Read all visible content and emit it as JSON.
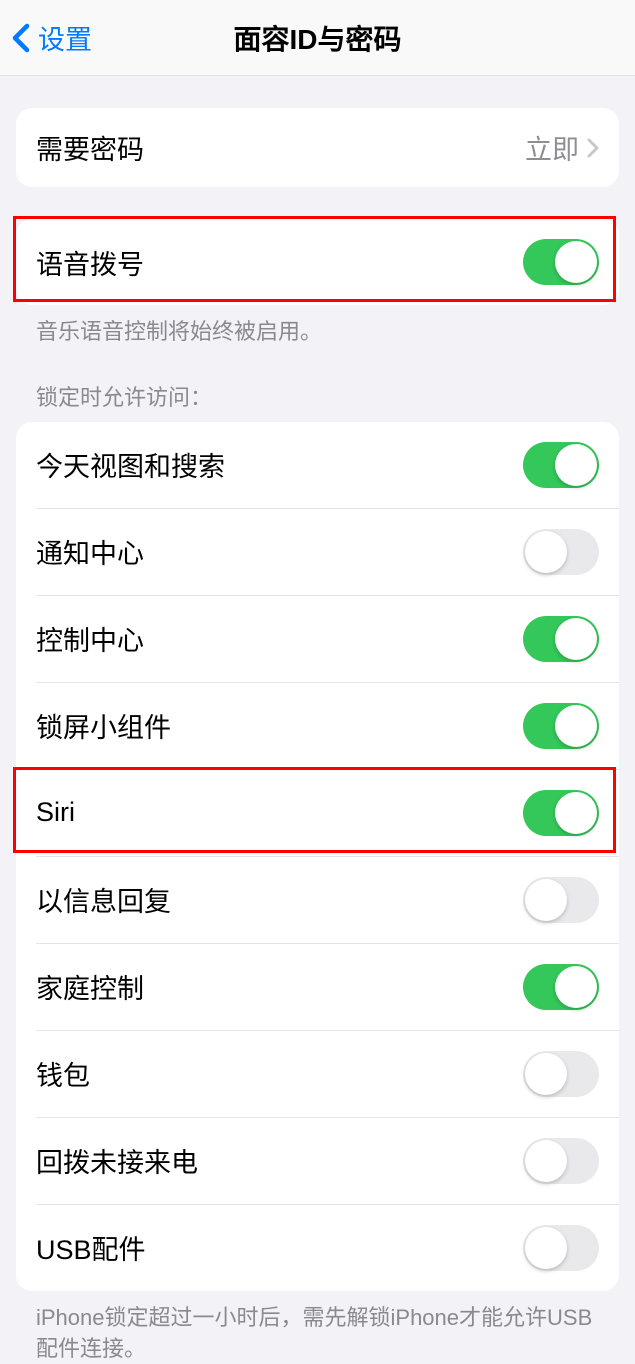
{
  "header": {
    "back_label": "设置",
    "title": "面容ID与密码"
  },
  "passcode_group": {
    "require_passcode": {
      "label": "需要密码",
      "value": "立即"
    }
  },
  "voice_group": {
    "voice_dial": {
      "label": "语音拨号",
      "on": true
    },
    "footer": "音乐语音控制将始终被启用。"
  },
  "lock_access": {
    "header": "锁定时允许访问：",
    "items": [
      {
        "key": "today",
        "label": "今天视图和搜索",
        "on": true
      },
      {
        "key": "notifications",
        "label": "通知中心",
        "on": false
      },
      {
        "key": "control",
        "label": "控制中心",
        "on": true
      },
      {
        "key": "widgets",
        "label": "锁屏小组件",
        "on": true
      },
      {
        "key": "siri",
        "label": "Siri",
        "on": true
      },
      {
        "key": "reply",
        "label": "以信息回复",
        "on": false
      },
      {
        "key": "home",
        "label": "家庭控制",
        "on": true
      },
      {
        "key": "wallet",
        "label": "钱包",
        "on": false
      },
      {
        "key": "callback",
        "label": "回拨未接来电",
        "on": false
      },
      {
        "key": "usb",
        "label": "USB配件",
        "on": false
      }
    ],
    "footer": "iPhone锁定超过一小时后，需先解锁iPhone才能允许USB配件连接。"
  }
}
